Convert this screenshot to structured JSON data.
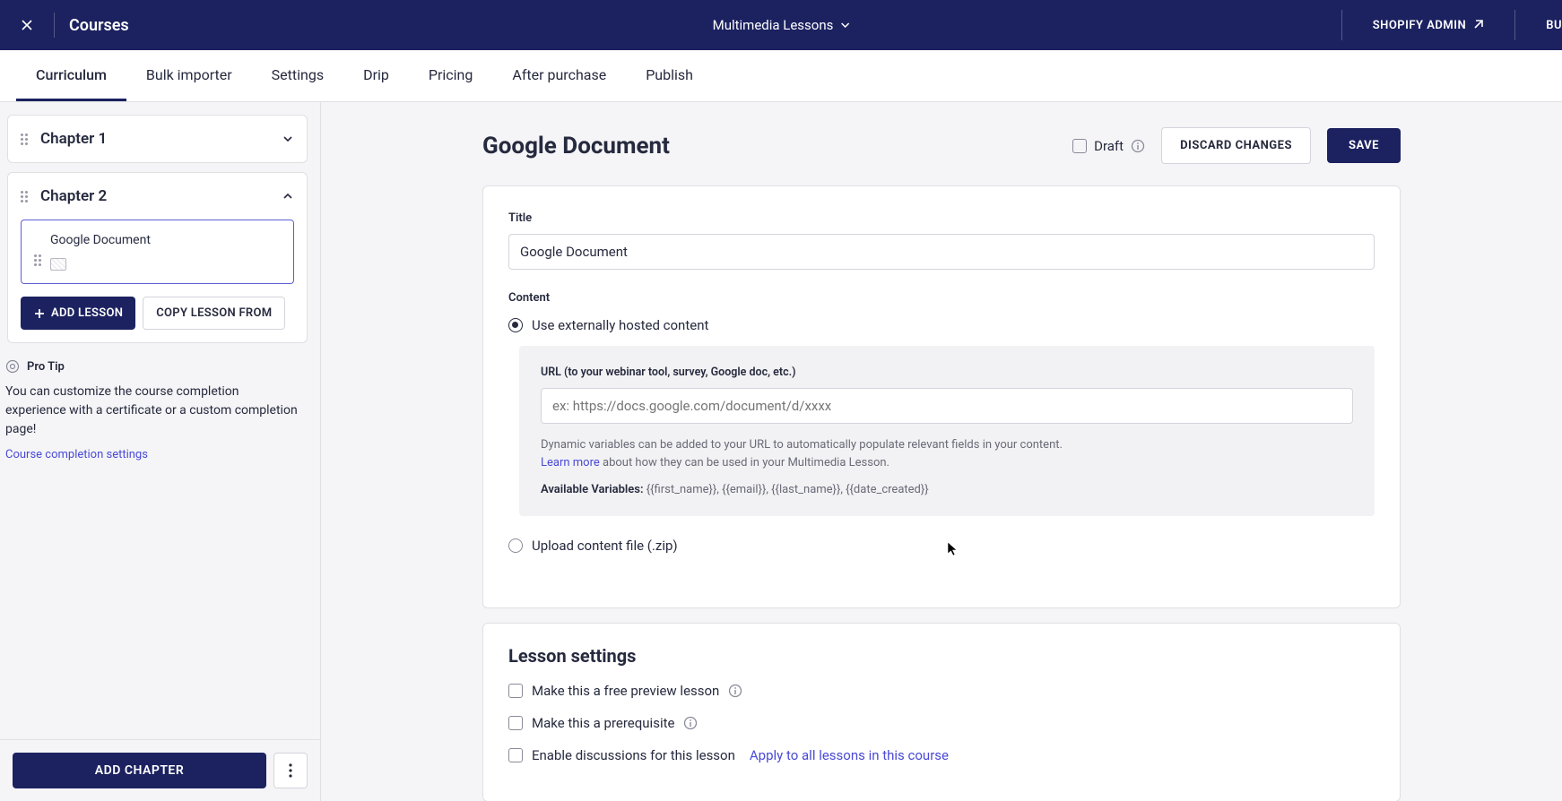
{
  "topbar": {
    "title": "Courses",
    "center_label": "Multimedia Lessons",
    "right": {
      "shopify": "SHOPIFY ADMIN",
      "extra": "BU"
    }
  },
  "tabs": [
    {
      "label": "Curriculum",
      "active": true
    },
    {
      "label": "Bulk importer"
    },
    {
      "label": "Settings"
    },
    {
      "label": "Drip"
    },
    {
      "label": "Pricing"
    },
    {
      "label": "After purchase"
    },
    {
      "label": "Publish"
    }
  ],
  "sidebar": {
    "chapters": {
      "ch1": {
        "title": "Chapter 1"
      },
      "ch2": {
        "title": "Chapter 2",
        "lesson": "Google Document",
        "add_lesson": "ADD LESSON",
        "copy_lesson": "COPY LESSON FROM"
      }
    },
    "protip": {
      "head": "Pro Tip",
      "body": "You can customize the course completion experience with a certificate or a custom completion page!",
      "link": "Course completion settings"
    },
    "footer": {
      "add_chapter": "ADD CHAPTER"
    }
  },
  "page": {
    "title": "Google Document",
    "draft_label": "Draft",
    "discard": "DISCARD CHANGES",
    "save": "SAVE"
  },
  "form": {
    "title_label": "Title",
    "title_value": "Google Document",
    "content_label": "Content",
    "radio_hosted": "Use externally hosted content",
    "radio_upload": "Upload content file (.zip)",
    "url_label": "URL (to your webinar tool, survey, Google doc, etc.)",
    "url_placeholder": "ex: https://docs.google.com/document/d/xxxx",
    "hint1": "Dynamic variables can be added to your URL to automatically populate relevant fields in your content.",
    "learn_more": "Learn more",
    "hint2": " about how they can be used in your Multimedia Lesson.",
    "vars_label": "Available Variables:",
    "vars_value": " {{first_name}}, {{email}}, {{last_name}}, {{date_created}}"
  },
  "settings": {
    "title": "Lesson settings",
    "free_preview": "Make this a free preview lesson",
    "prerequisite": "Make this a prerequisite",
    "discussions": "Enable discussions for this lesson",
    "apply_all": "Apply to all lessons in this course"
  }
}
